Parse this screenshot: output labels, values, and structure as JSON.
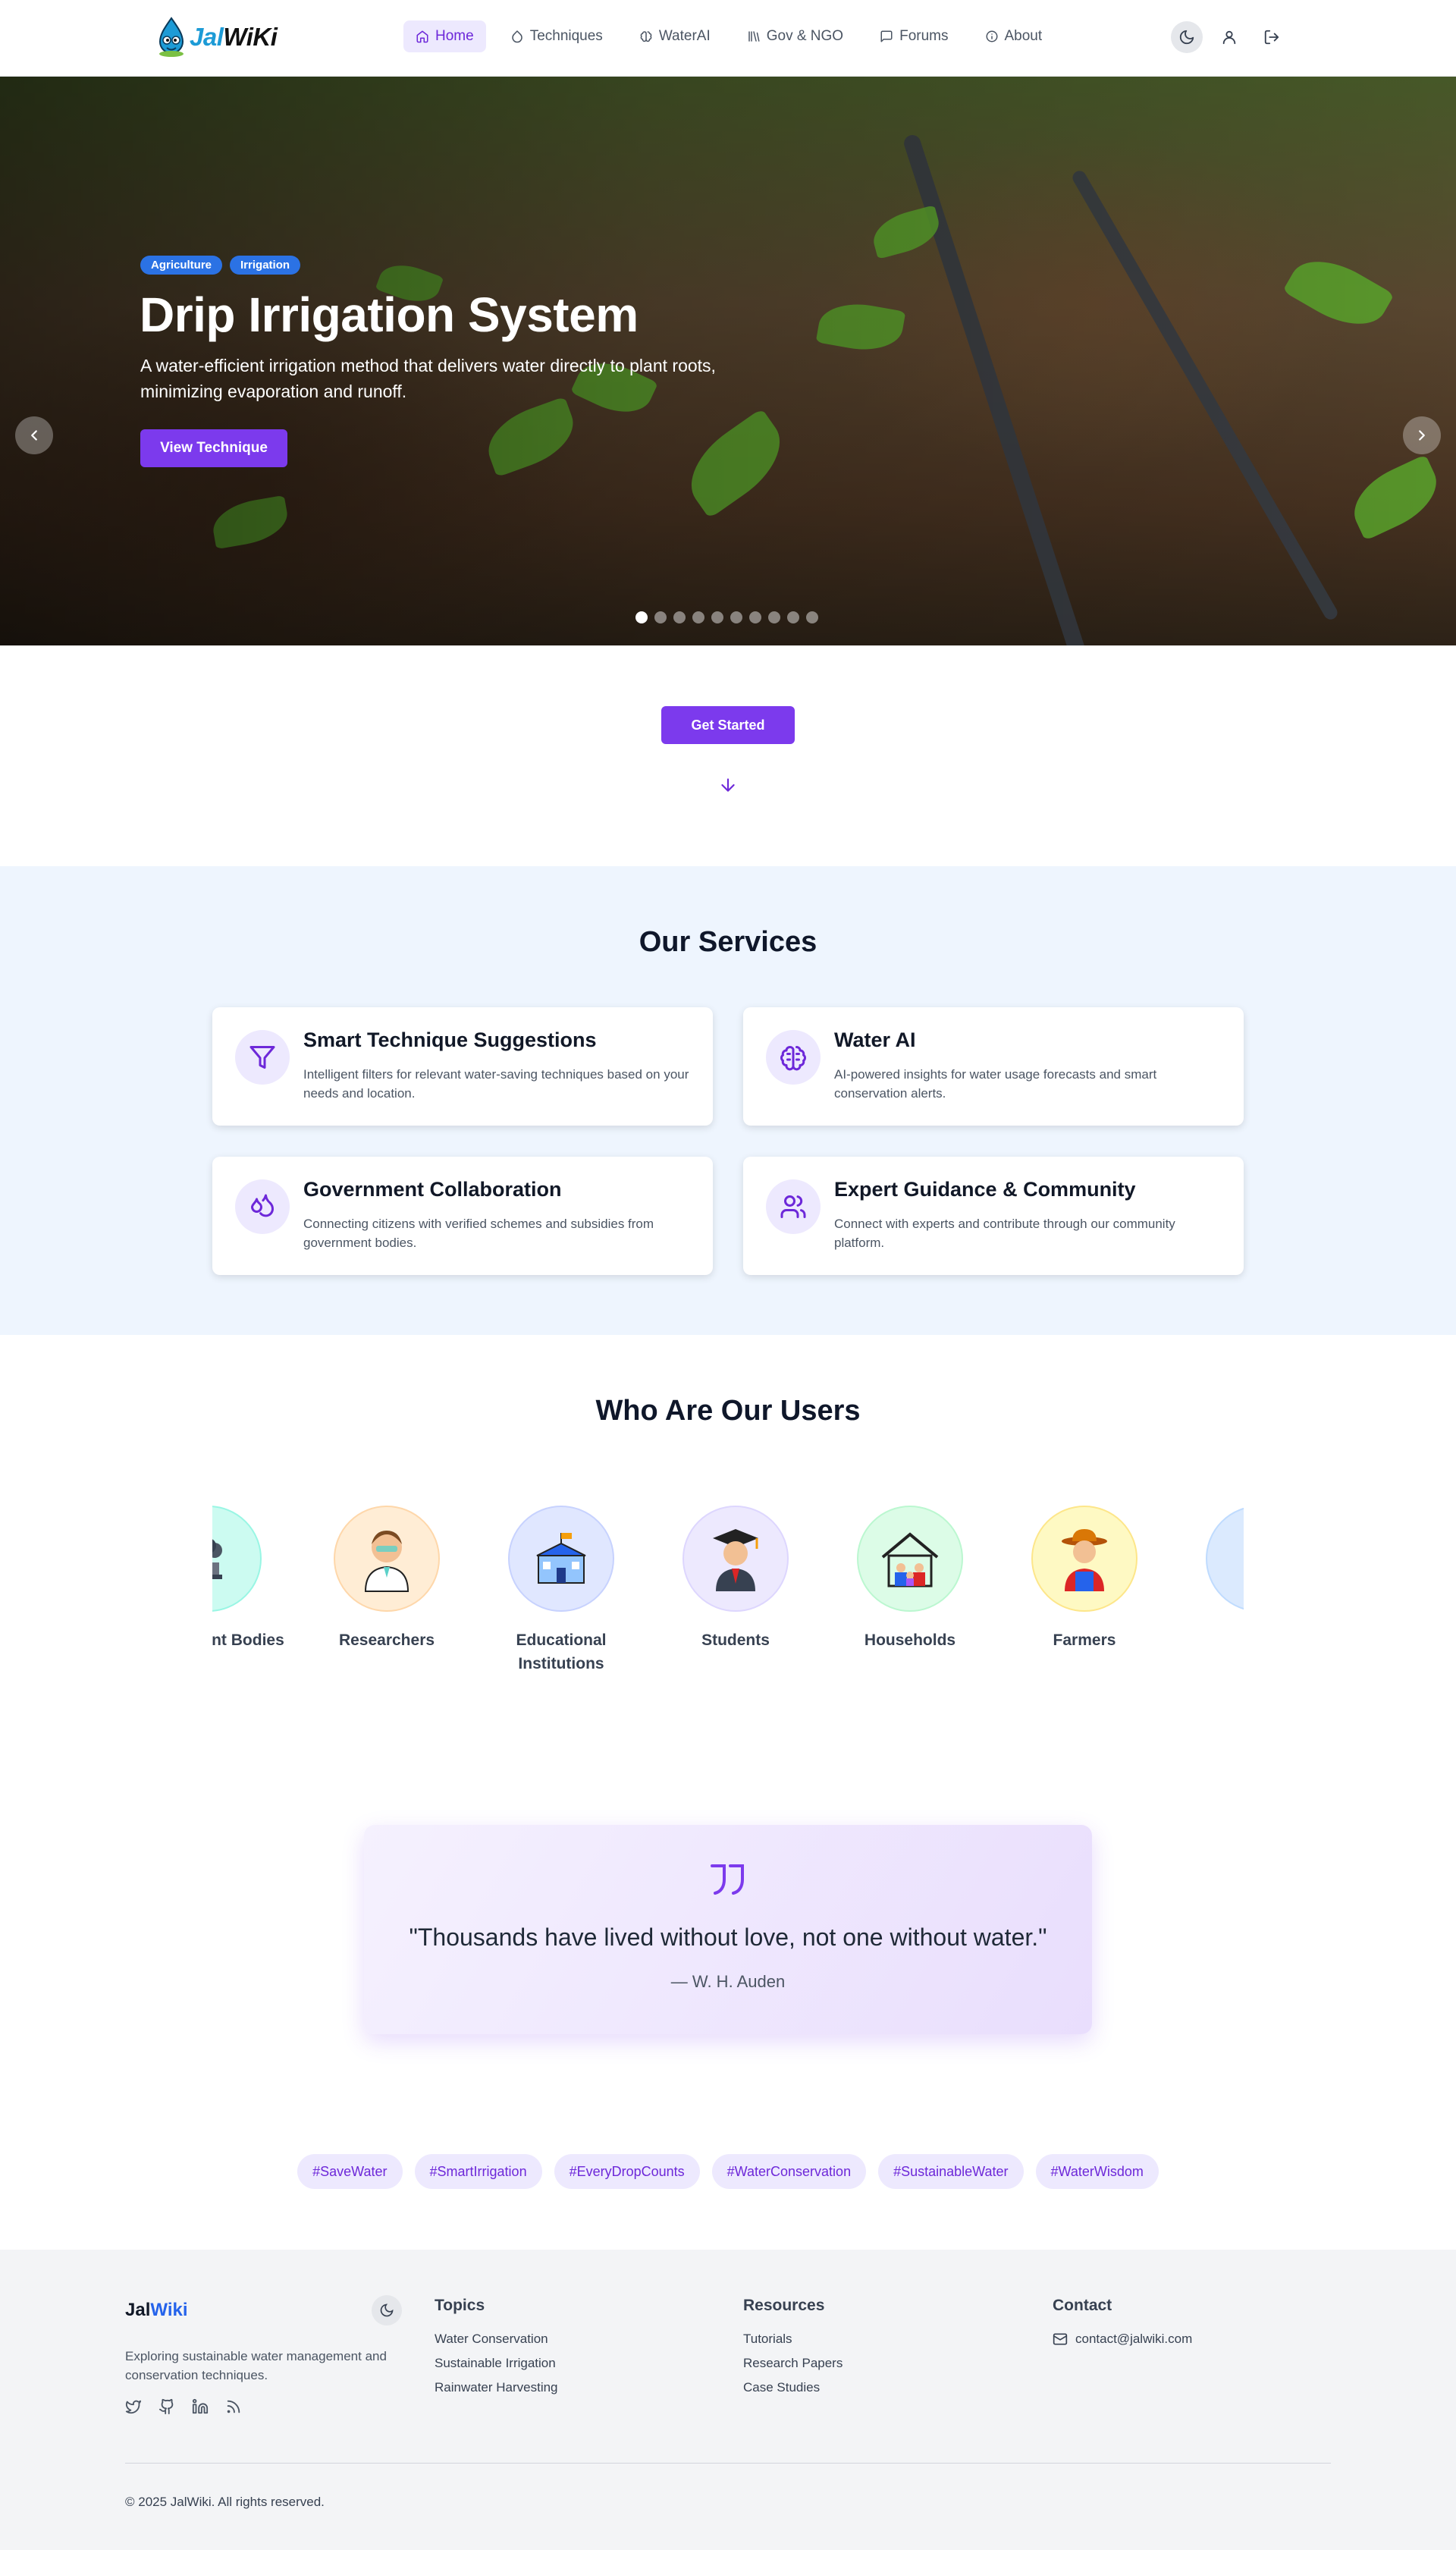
{
  "nav": {
    "logo_prefix": "Jal",
    "logo_suffix": "WiKi",
    "items": [
      {
        "label": "Home",
        "icon": "home-icon",
        "active": true
      },
      {
        "label": "Techniques",
        "icon": "droplet-icon"
      },
      {
        "label": "WaterAI",
        "icon": "brain-icon"
      },
      {
        "label": "Gov & NGO",
        "icon": "library-icon"
      },
      {
        "label": "Forums",
        "icon": "message-square-icon"
      },
      {
        "label": "About",
        "icon": "info-icon"
      }
    ]
  },
  "hero": {
    "tags": [
      "Agriculture",
      "Irrigation"
    ],
    "title": "Drip Irrigation System",
    "description": "A water-efficient irrigation method that delivers water directly to plant roots, minimizing evaporation and runoff.",
    "button": "View Technique",
    "slide_count": 10,
    "active_slide": 0
  },
  "cta": {
    "button": "Get Started"
  },
  "services": {
    "title": "Our Services",
    "items": [
      {
        "title": "Smart Technique Suggestions",
        "desc": "Intelligent filters for relevant water-saving techniques based on your needs and location.",
        "icon": "filter-icon"
      },
      {
        "title": "Water AI",
        "desc": "AI-powered insights for water usage forecasts and smart conservation alerts.",
        "icon": "brain-icon"
      },
      {
        "title": "Government Collaboration",
        "desc": "Connecting citizens with verified schemes and subsidies from government bodies.",
        "icon": "droplets-icon"
      },
      {
        "title": "Expert Guidance & Community",
        "desc": "Connect with experts and contribute through our community platform.",
        "icon": "users-icon"
      }
    ]
  },
  "users": {
    "title": "Who Are Our Users",
    "items": [
      {
        "label": "Government Bodies",
        "color": "#ccfbf1"
      },
      {
        "label": "Researchers",
        "color": "#ffedd5"
      },
      {
        "label": "Educational Institutions",
        "color": "#e0e7ff"
      },
      {
        "label": "Students",
        "color": "#ede9fe"
      },
      {
        "label": "Households",
        "color": "#dcfce7"
      },
      {
        "label": "Farmers",
        "color": "#fef9c3"
      },
      {
        "label": "",
        "color": "#dbeafe"
      }
    ]
  },
  "quote": {
    "text": "\"Thousands have lived without love, not one without water.\"",
    "author": "— W. H. Auden"
  },
  "hashtags": [
    "#SaveWater",
    "#SmartIrrigation",
    "#EveryDropCounts",
    "#WaterConservation",
    "#SustainableWater",
    "#WaterWisdom"
  ],
  "footer": {
    "brand_prefix": "Jal",
    "brand_suffix": "Wiki",
    "description": "Exploring sustainable water management and conservation techniques.",
    "topics_title": "Topics",
    "topics": [
      "Water Conservation",
      "Sustainable Irrigation",
      "Rainwater Harvesting"
    ],
    "resources_title": "Resources",
    "resources": [
      "Tutorials",
      "Research Papers",
      "Case Studies"
    ],
    "contact_title": "Contact",
    "email": "contact@jalwiki.com",
    "copyright": "© 2025 JalWiki. All rights reserved."
  },
  "colors": {
    "accent": "#7c3aed",
    "tag": "#2b72e4",
    "brand_blue": "#1d9bd6"
  }
}
